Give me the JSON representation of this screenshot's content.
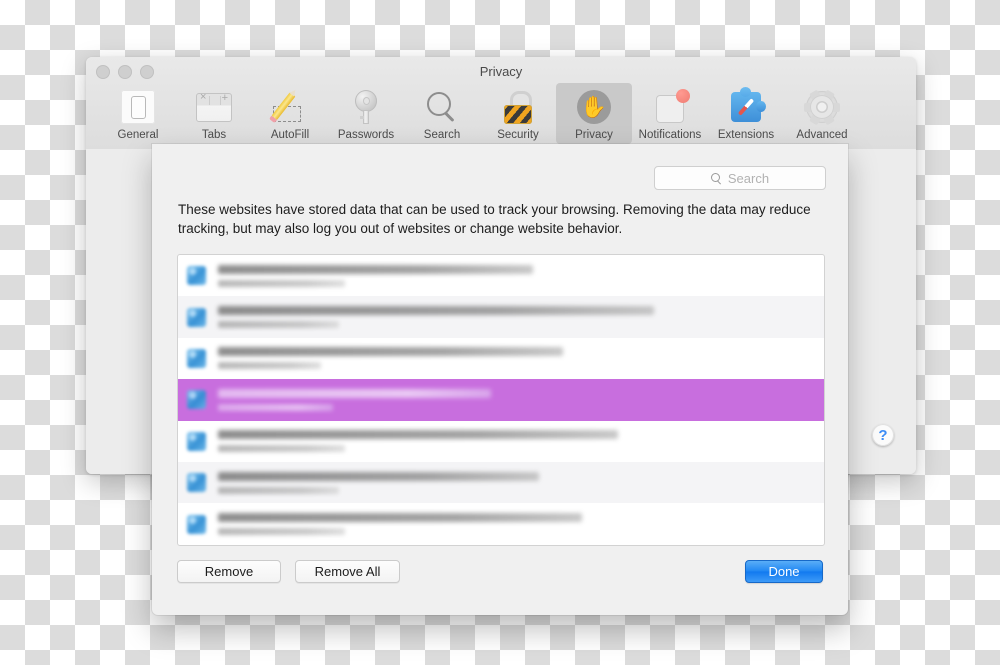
{
  "window": {
    "title": "Privacy",
    "traffic_lights": [
      "close",
      "minimize",
      "zoom"
    ]
  },
  "toolbar": {
    "items": [
      {
        "label": "General",
        "icon": "general-icon",
        "selected": false
      },
      {
        "label": "Tabs",
        "icon": "tabs-icon",
        "selected": false
      },
      {
        "label": "AutoFill",
        "icon": "autofill-icon",
        "selected": false
      },
      {
        "label": "Passwords",
        "icon": "key-icon",
        "selected": false
      },
      {
        "label": "Search",
        "icon": "magnifier-icon",
        "selected": false
      },
      {
        "label": "Security",
        "icon": "lock-icon",
        "selected": false
      },
      {
        "label": "Privacy",
        "icon": "hand-icon",
        "selected": true
      },
      {
        "label": "Notifications",
        "icon": "notification-icon",
        "selected": false
      },
      {
        "label": "Extensions",
        "icon": "puzzle-piece-icon",
        "selected": false
      },
      {
        "label": "Advanced",
        "icon": "gear-icon",
        "selected": false
      }
    ]
  },
  "help": {
    "label": "?"
  },
  "sheet": {
    "search": {
      "placeholder": "Search",
      "value": "",
      "icon": "search-icon"
    },
    "description": "These websites have stored data that can be used to track your browsing. Removing the data may reduce tracking, but may also log you out of websites or change website behavior.",
    "site_list": {
      "rows": [
        {
          "name": "",
          "detail": "",
          "icon": "website-globe-icon",
          "selected": false
        },
        {
          "name": "",
          "detail": "",
          "icon": "website-globe-icon",
          "selected": false
        },
        {
          "name": "",
          "detail": "",
          "icon": "website-globe-icon",
          "selected": false
        },
        {
          "name": "",
          "detail": "",
          "icon": "website-globe-icon",
          "selected": true
        },
        {
          "name": "",
          "detail": "",
          "icon": "website-globe-icon",
          "selected": false
        },
        {
          "name": "",
          "detail": "",
          "icon": "website-globe-icon",
          "selected": false
        },
        {
          "name": "",
          "detail": "",
          "icon": "website-globe-icon",
          "selected": false
        }
      ],
      "redacted": true
    },
    "buttons": {
      "remove": "Remove",
      "remove_all": "Remove All",
      "done": "Done"
    }
  },
  "colors": {
    "selection_highlight": "#c86ede",
    "default_button": "#1f86f3",
    "help_accent": "#3b8cf6",
    "toolbar_selected": "#c9c9c9",
    "notification_badge": "#ef7c72",
    "checkerboard": "#dcdcdc"
  }
}
